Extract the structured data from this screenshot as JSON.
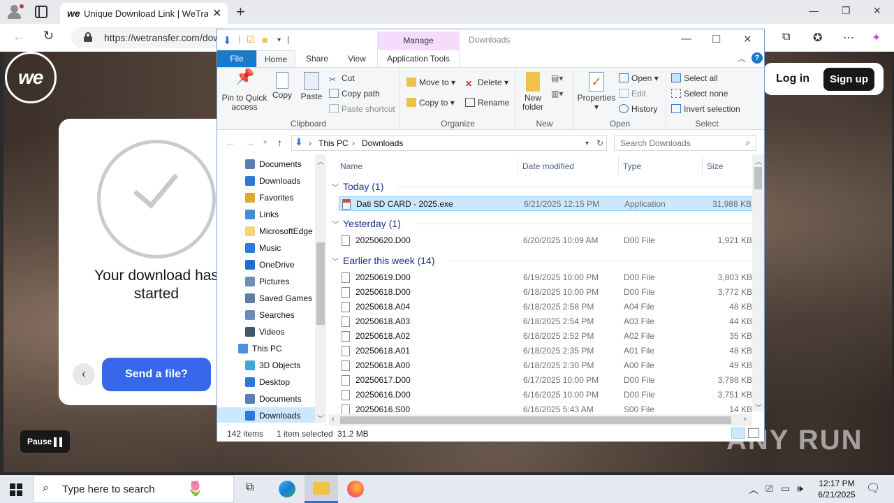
{
  "browser": {
    "tab_title": "Unique Download Link | WeTransfer",
    "tab_favicon": "we",
    "url": "https://wetransfer.com/downloads"
  },
  "wetransfer": {
    "logo": "we",
    "login_label": "Log in",
    "signup_label": "Sign up",
    "download_title": "Your download has started",
    "send_label": "Send a file?",
    "pause_label": "Pause"
  },
  "explorer": {
    "qat_path": "|",
    "manage_label": "Manage",
    "window_title": "Downloads",
    "tabs": [
      "File",
      "Home",
      "Share",
      "View",
      "Application Tools"
    ],
    "ribbon": {
      "clipboard": {
        "label": "Clipboard",
        "pin": "Pin to Quick access",
        "copy": "Copy",
        "paste": "Paste",
        "cut": "Cut",
        "copy_path": "Copy path",
        "paste_shortcut": "Paste shortcut"
      },
      "organize": {
        "label": "Organize",
        "move_to": "Move to",
        "copy_to": "Copy to",
        "delete": "Delete",
        "rename": "Rename"
      },
      "new": {
        "label": "New",
        "new_folder": "New folder"
      },
      "open": {
        "label": "Open",
        "properties": "Properties",
        "open": "Open",
        "edit": "Edit",
        "history": "History"
      },
      "select": {
        "label": "Select",
        "select_all": "Select all",
        "select_none": "Select none",
        "invert": "Invert selection"
      }
    },
    "breadcrumb": [
      "This PC",
      "Downloads"
    ],
    "search_placeholder": "Search Downloads",
    "nav_items": [
      {
        "label": "Documents",
        "icon": "documents-icon",
        "color": "#5a7fb0"
      },
      {
        "label": "Downloads",
        "icon": "downloads-icon",
        "color": "#2b79d8"
      },
      {
        "label": "Favorites",
        "icon": "favorites-icon",
        "color": "#e0a82e"
      },
      {
        "label": "Links",
        "icon": "links-icon",
        "color": "#3c8fd8"
      },
      {
        "label": "MicrosoftEdge",
        "icon": "folder-icon",
        "color": "#f3d57a"
      },
      {
        "label": "Music",
        "icon": "music-icon",
        "color": "#2b79d8"
      },
      {
        "label": "OneDrive",
        "icon": "onedrive-icon",
        "color": "#1c6fd0"
      },
      {
        "label": "Pictures",
        "icon": "pictures-icon",
        "color": "#6f8db7"
      },
      {
        "label": "Saved Games",
        "icon": "saved-games-icon",
        "color": "#5e7ea6"
      },
      {
        "label": "Searches",
        "icon": "searches-icon",
        "color": "#6b8cb7"
      },
      {
        "label": "Videos",
        "icon": "videos-icon",
        "color": "#40586e"
      },
      {
        "label": "This PC",
        "icon": "this-pc-icon",
        "color": "#4a8fd8"
      },
      {
        "label": "3D Objects",
        "icon": "3d-objects-icon",
        "color": "#3aa9d9"
      },
      {
        "label": "Desktop",
        "icon": "desktop-icon",
        "color": "#2b79d8"
      },
      {
        "label": "Documents",
        "icon": "documents-icon",
        "color": "#5a7fb0"
      },
      {
        "label": "Downloads",
        "icon": "downloads-icon",
        "color": "#2b79d8"
      }
    ],
    "columns": [
      "Name",
      "Date modified",
      "Type",
      "Size"
    ],
    "groups": {
      "today": "Today (1)",
      "yesterday": "Yesterday (1)",
      "week": "Earlier this week (14)"
    },
    "files_today": [
      {
        "name": "Dati SD CARD - 2025.exe",
        "date": "6/21/2025 12:15 PM",
        "type": "Application",
        "size": "31,988 KB"
      }
    ],
    "files_yesterday": [
      {
        "name": "20250620.D00",
        "date": "6/20/2025 10:09 AM",
        "type": "D00 File",
        "size": "1,921 KB"
      }
    ],
    "files_week": [
      {
        "name": "20250619.D00",
        "date": "6/19/2025 10:00 PM",
        "type": "D00 File",
        "size": "3,803 KB"
      },
      {
        "name": "20250618.D00",
        "date": "6/18/2025 10:00 PM",
        "type": "D00 File",
        "size": "3,772 KB"
      },
      {
        "name": "20250618.A04",
        "date": "6/18/2025 2:58 PM",
        "type": "A04 File",
        "size": "48 KB"
      },
      {
        "name": "20250618.A03",
        "date": "6/18/2025 2:54 PM",
        "type": "A03 File",
        "size": "44 KB"
      },
      {
        "name": "20250618.A02",
        "date": "6/18/2025 2:52 PM",
        "type": "A02 File",
        "size": "35 KB"
      },
      {
        "name": "20250618.A01",
        "date": "6/18/2025 2:35 PM",
        "type": "A01 File",
        "size": "48 KB"
      },
      {
        "name": "20250618.A00",
        "date": "6/18/2025 2:30 PM",
        "type": "A00 File",
        "size": "49 KB"
      },
      {
        "name": "20250617.D00",
        "date": "6/17/2025 10:00 PM",
        "type": "D00 File",
        "size": "3,798 KB"
      },
      {
        "name": "20250616.D00",
        "date": "6/16/2025 10:00 PM",
        "type": "D00 File",
        "size": "3,751 KB"
      },
      {
        "name": "20250616.S00",
        "date": "6/16/2025 5:43 AM",
        "type": "S00 File",
        "size": "14 KB"
      }
    ],
    "status": {
      "items": "142 items",
      "selected": "1 item selected",
      "size": "31.2 MB"
    }
  },
  "taskbar": {
    "search_text": "Type here to search",
    "time": "12:17 PM",
    "date": "6/21/2025"
  },
  "watermark": "ANY RUN"
}
